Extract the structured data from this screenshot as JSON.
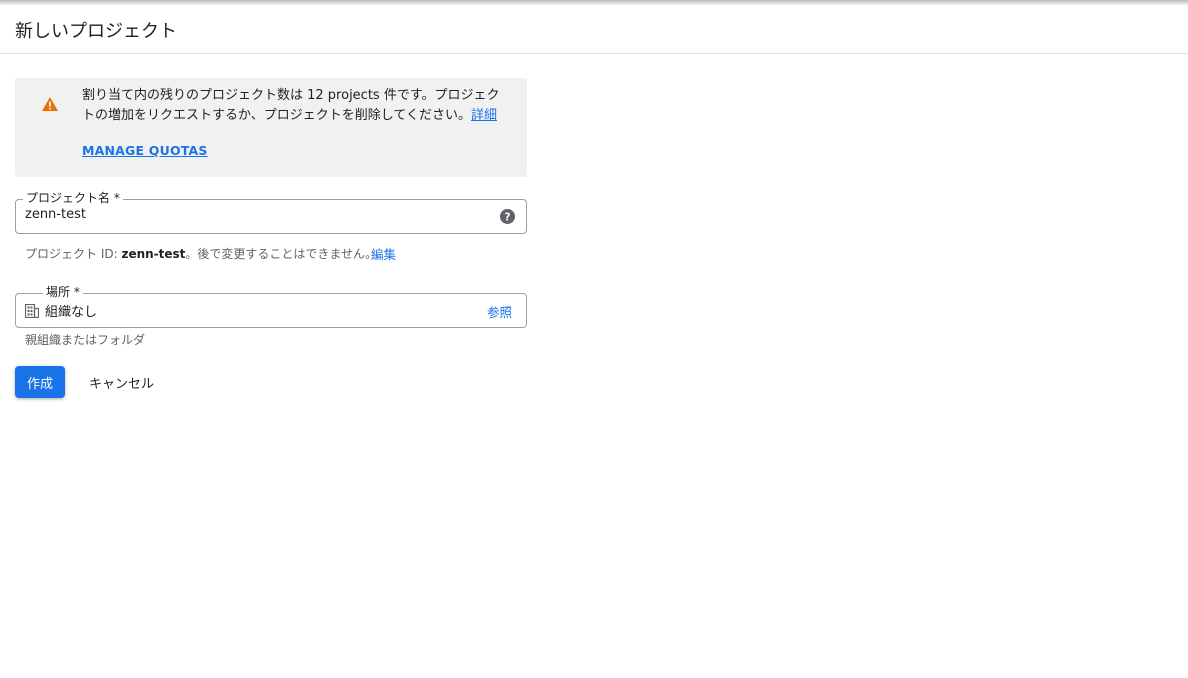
{
  "page": {
    "title": "新しいプロジェクト"
  },
  "alert": {
    "message": "割り当て内の残りのプロジェクト数は 12 projects 件です。プロジェクトの増加をリクエストするか、プロジェクトを削除してください。",
    "learn_more_label": "詳細",
    "manage_quotas_label": "MANAGE QUOTAS",
    "icon": "warning-icon",
    "icon_color": "#e8710a"
  },
  "project_name": {
    "label": "プロジェクト名 *",
    "value": "zenn-test",
    "help_icon": "help-icon"
  },
  "project_id": {
    "prefix": "プロジェクト ID: ",
    "id": "zenn-test",
    "suffix": "。後で変更することはできません。",
    "edit_label": "編集"
  },
  "location": {
    "label": "場所 *",
    "value": "組織なし",
    "browse_label": "参照",
    "hint": "親組織またはフォルダ",
    "icon": "organization-icon"
  },
  "actions": {
    "create_label": "作成",
    "cancel_label": "キャンセル"
  },
  "colors": {
    "accent": "#1a73e8",
    "alert_background": "#f1f1f1",
    "warning": "#e8710a"
  }
}
